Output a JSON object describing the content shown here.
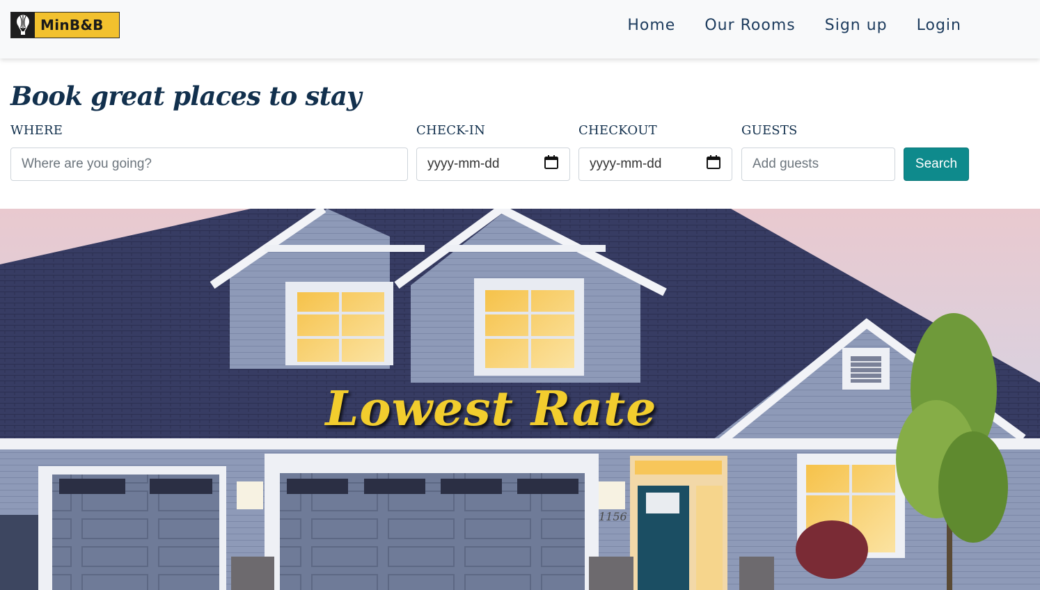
{
  "brand": {
    "name": "MinB&B",
    "logo_icon": "hot-air-balloon-icon",
    "colors": {
      "logo_bg": "#f2c12e",
      "logo_icon_bg": "#1e1e1e"
    }
  },
  "nav": {
    "links": [
      {
        "label": "Home"
      },
      {
        "label": "Our Rooms"
      },
      {
        "label": "Sign up"
      },
      {
        "label": "Login"
      }
    ],
    "color": "#1b3a5c"
  },
  "search": {
    "headline": "Book great places to stay",
    "where": {
      "label": "WHERE",
      "placeholder": "Where are you going?"
    },
    "checkin": {
      "label": "CHECK-IN",
      "value": "yyyy-mm-dd",
      "icon": "calendar-icon"
    },
    "checkout": {
      "label": "CHECKOUT",
      "value": "yyyy-mm-dd",
      "icon": "calendar-icon"
    },
    "guests": {
      "label": "GUESTS",
      "placeholder": "Add guests"
    },
    "button_label": "Search",
    "button_color": "#0e8a8c"
  },
  "hero": {
    "title": "Lowest Rate",
    "title_color": "#f2cd2e",
    "house_number": "1156"
  }
}
